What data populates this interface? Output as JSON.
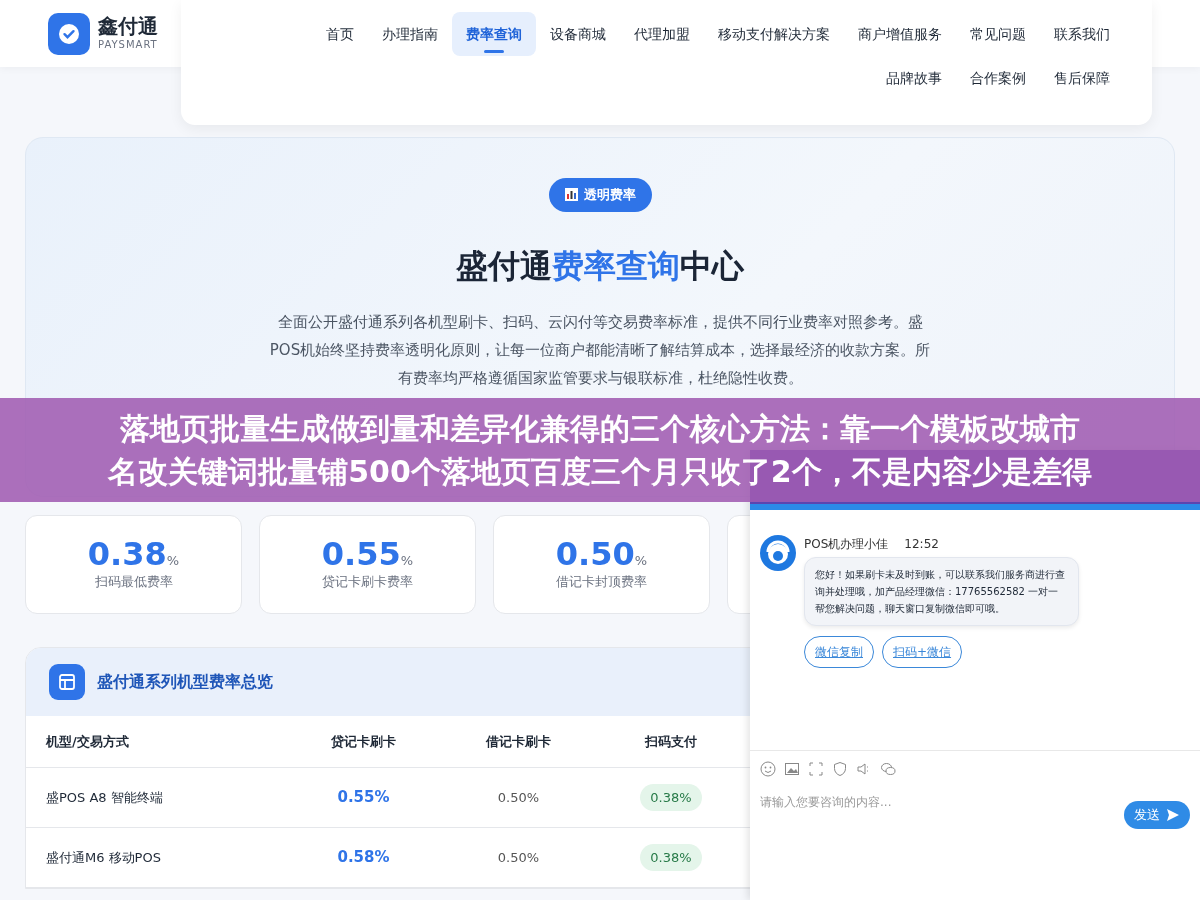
{
  "brand": {
    "name": "鑫付通",
    "tagline": "PAYSMART"
  },
  "nav": [
    {
      "label": "首页",
      "selected": false
    },
    {
      "label": "办理指南",
      "selected": false
    },
    {
      "label": "费率查询",
      "selected": true
    },
    {
      "label": "设备商城",
      "selected": false
    },
    {
      "label": "代理加盟",
      "selected": false
    },
    {
      "label": "移动支付解决方案",
      "selected": false
    },
    {
      "label": "商户增值服务",
      "selected": false
    },
    {
      "label": "常见问题",
      "selected": false
    },
    {
      "label": "联系我们",
      "selected": false
    },
    {
      "label": "品牌故事",
      "selected": false
    },
    {
      "label": "合作案例",
      "selected": false
    },
    {
      "label": "售后保障",
      "selected": false
    }
  ],
  "hero": {
    "badge": "透明费率",
    "title_prefix": "盛付通",
    "title_highlight": "费率查询",
    "title_suffix": "中心",
    "description": "全面公开盛付通系列各机型刷卡、扫码、云闪付等交易费率标准，提供不同行业费率对照参考。盛POS机始终坚持费率透明化原则，让每一位商户都能清晰了解结算成本，选择最经济的收款方案。所有费率均严格遵循国家监管要求与银联标准，杜绝隐性收费。"
  },
  "stats": [
    {
      "value": "0.38",
      "unit": "%",
      "label": "扫码最低费率"
    },
    {
      "value": "0.55",
      "unit": "%",
      "label": "贷记卡刷卡费率"
    },
    {
      "value": "0.50",
      "unit": "%",
      "label": "借记卡封顶费率"
    }
  ],
  "rate_table": {
    "title": "盛付通系列机型费率总览",
    "columns": [
      "机型/交易方式",
      "贷记卡刷卡",
      "借记卡刷卡",
      "扫码支付"
    ],
    "rows": [
      {
        "cells": [
          "盛POS A8 智能终端",
          "0.55%",
          "0.50%",
          "0.38%"
        ]
      },
      {
        "cells": [
          "盛付通M6 移动POS",
          "0.58%",
          "0.50%",
          "0.38%"
        ]
      }
    ]
  },
  "chat": {
    "agent": "POS机办理小佳",
    "time": "12:52",
    "message": "您好！如果刷卡未及时到账，可以联系我们服务商进行查询并处理哦，加产品经理微信：17765562582 一对一帮您解决问题，聊天窗口复制微信即可哦。",
    "quick_replies": [
      "微信复制",
      "扫码+微信"
    ],
    "placeholder": "请输入您要咨询的内容...",
    "send": "发送"
  },
  "overlay_banner": {
    "lines": [
      "落地页批量生成做到量和差异化兼得的三个核心方法：靠一个模板改城市",
      "名改关键词批量铺500个落地页百度三个月只收了2个，不是内容少是差得"
    ]
  }
}
